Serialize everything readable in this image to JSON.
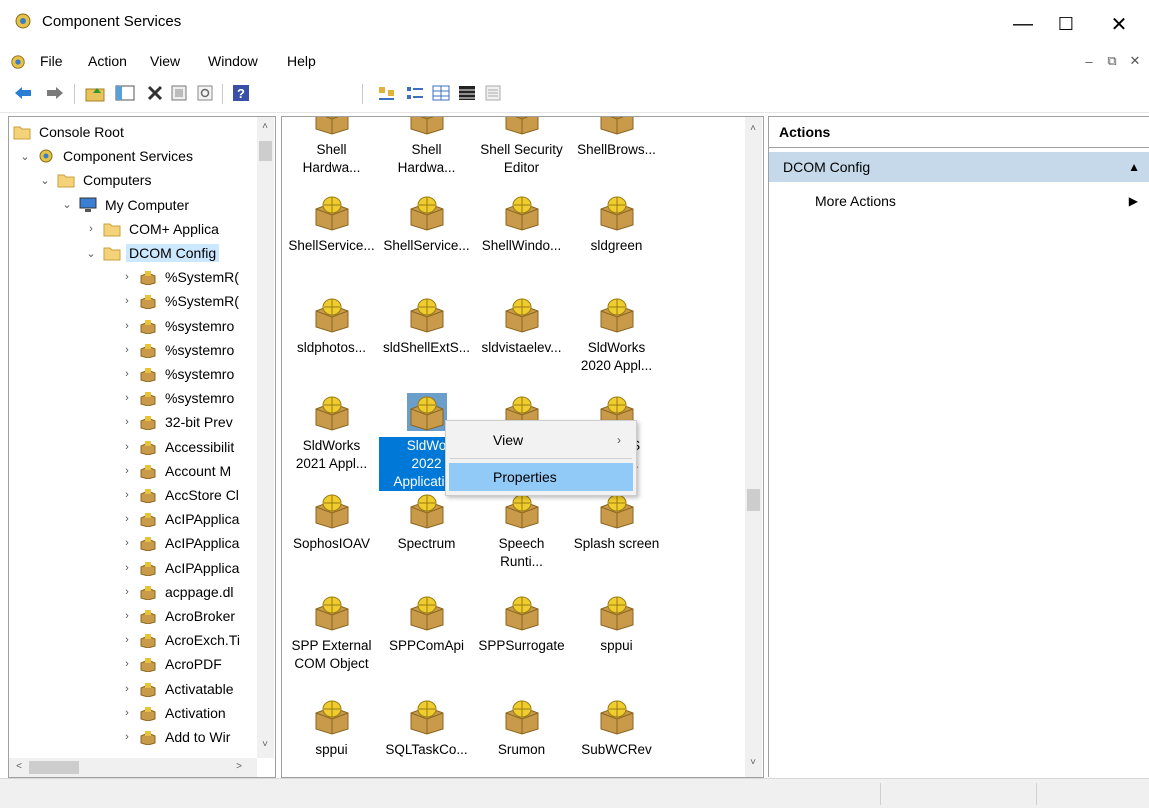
{
  "window": {
    "title": "Component Services"
  },
  "menu": [
    "File",
    "Action",
    "View",
    "Window",
    "Help"
  ],
  "tree": [
    {
      "label": "Console Root",
      "level": 0,
      "twisty": "",
      "icon": "folder-icon"
    },
    {
      "label": "Component Services",
      "level": 1,
      "twisty": "⌄",
      "icon": "component-services-icon"
    },
    {
      "label": "Computers",
      "level": 2,
      "twisty": "⌄",
      "icon": "folder-icon"
    },
    {
      "label": "My Computer",
      "level": 3,
      "twisty": "⌄",
      "icon": "computer-icon"
    },
    {
      "label": "COM+ Applica",
      "level": 4,
      "twisty": "›",
      "icon": "folder-icon"
    },
    {
      "label": "DCOM Config",
      "level": 4,
      "twisty": "⌄",
      "icon": "folder-icon",
      "selected": true
    },
    {
      "label": "%SystemR(",
      "level": 5,
      "twisty": "›",
      "icon": "component-box-icon"
    },
    {
      "label": "%SystemR(",
      "level": 5,
      "twisty": "›",
      "icon": "component-box-icon"
    },
    {
      "label": "%systemro",
      "level": 5,
      "twisty": "›",
      "icon": "component-box-icon"
    },
    {
      "label": "%systemro",
      "level": 5,
      "twisty": "›",
      "icon": "component-box-icon"
    },
    {
      "label": "%systemro",
      "level": 5,
      "twisty": "›",
      "icon": "component-box-icon"
    },
    {
      "label": "%systemro",
      "level": 5,
      "twisty": "›",
      "icon": "component-box-icon"
    },
    {
      "label": "32-bit Prev",
      "level": 5,
      "twisty": "›",
      "icon": "component-box-icon"
    },
    {
      "label": "Accessibilit",
      "level": 5,
      "twisty": "›",
      "icon": "component-box-icon"
    },
    {
      "label": "Account M",
      "level": 5,
      "twisty": "›",
      "icon": "component-box-icon"
    },
    {
      "label": "AccStore Cl",
      "level": 5,
      "twisty": "›",
      "icon": "component-box-icon"
    },
    {
      "label": "AcIPApplica",
      "level": 5,
      "twisty": "›",
      "icon": "component-box-icon"
    },
    {
      "label": "AcIPApplica",
      "level": 5,
      "twisty": "›",
      "icon": "component-box-icon"
    },
    {
      "label": "AcIPApplica",
      "level": 5,
      "twisty": "›",
      "icon": "component-box-icon"
    },
    {
      "label": "acppage.dl",
      "level": 5,
      "twisty": "›",
      "icon": "component-box-icon"
    },
    {
      "label": "AcroBroker",
      "level": 5,
      "twisty": "›",
      "icon": "component-box-icon"
    },
    {
      "label": "AcroExch.Ti",
      "level": 5,
      "twisty": "›",
      "icon": "component-box-icon"
    },
    {
      "label": "AcroPDF",
      "level": 5,
      "twisty": "›",
      "icon": "component-box-icon"
    },
    {
      "label": "Activatable",
      "level": 5,
      "twisty": "›",
      "icon": "component-box-icon"
    },
    {
      "label": "Activation",
      "level": 5,
      "twisty": "›",
      "icon": "component-box-icon"
    },
    {
      "label": "Add to Wir",
      "level": 5,
      "twisty": "›",
      "icon": "component-box-icon"
    }
  ],
  "list_rows": [
    [
      "Shell Hardwa...",
      "Shell Hardwa...",
      "Shell Security Editor",
      "ShellBrows..."
    ],
    [
      "ShellService...",
      "ShellService...",
      "ShellWindo...",
      "sldgreen"
    ],
    [
      "sldphotos...",
      "sldShellExtS...",
      "sldvistaelev...",
      "SldWorks 2020 Appl..."
    ],
    [
      "SldWorks 2021 Appl...",
      "SldWorks 2022 Application",
      "",
      "SOLIDWORKS Docum..."
    ],
    [
      "SophosIOAV",
      "Spectrum",
      "Speech Runti...",
      "Splash screen"
    ],
    [
      "SPP External COM Object",
      "SPPComApi",
      "SPPSurrogate",
      "sppui"
    ],
    [
      "sppui",
      "SQLTaskCo...",
      "Srumon",
      "SubWCRev"
    ]
  ],
  "list_visible_labels": [
    [
      "Shell\nHardwa...",
      "Shell\nHardwa...",
      "Shell Security\nEditor",
      "ShellBrows..."
    ],
    [
      "ShellService...",
      "ShellService...",
      "ShellWindo...",
      "sldgreen"
    ],
    [
      "sldphotos...",
      "sldShellExtS...",
      "sldvistaelev...",
      "SldWorks\n2020 Appl..."
    ],
    [
      "SldWorks\n2021 Appl...",
      "SldWo\n2022\nApplication",
      "",
      "VORKS\nocum..."
    ],
    [
      "SophosIOAV",
      "Spectrum",
      "Speech\nRunti...",
      "Splash screen"
    ],
    [
      "SPP External\nCOM Object",
      "SPPComApi",
      "SPPSurrogate",
      "sppui"
    ],
    [
      "sppui",
      "SQLTaskCo...",
      "Srumon",
      "SubWCRev"
    ]
  ],
  "context_menu": {
    "items": [
      "View",
      "Properties"
    ],
    "highlighted": "Properties"
  },
  "actions": {
    "header": "Actions",
    "section": "DCOM Config",
    "more": "More Actions"
  },
  "colors": {
    "selection": "#0078d7",
    "tree_selection": "#cce8ff",
    "actions_section": "#c6d9ea",
    "menu_highlight": "#91c9f7"
  }
}
